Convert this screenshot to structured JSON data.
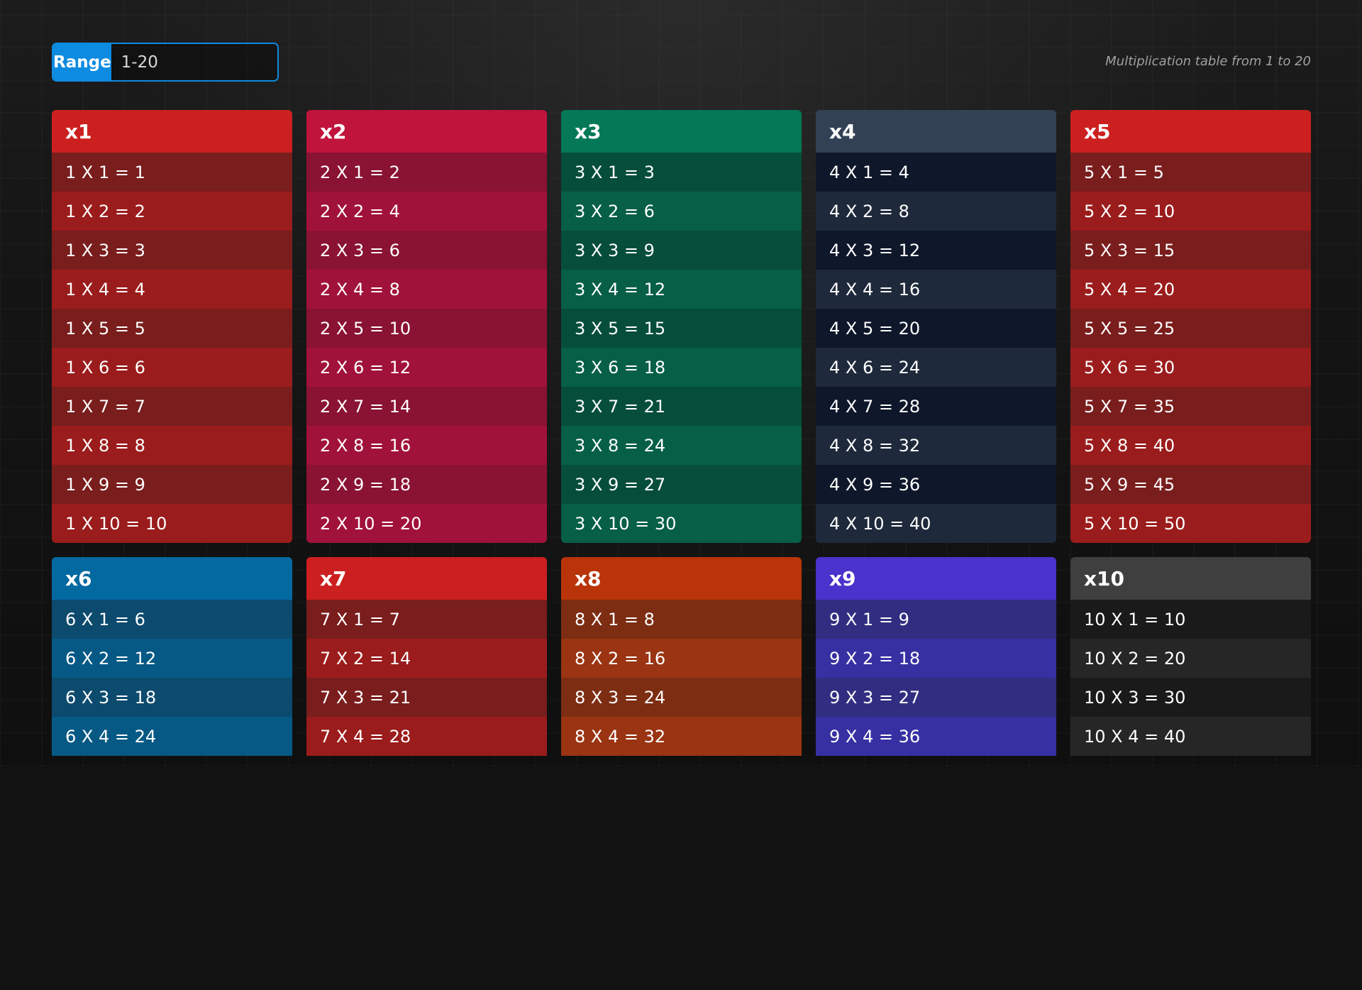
{
  "range": {
    "label": "Range",
    "value": "1-20"
  },
  "subtitle": "Multiplication table from 1 to 20",
  "tables": [
    {
      "title": "x1",
      "header": "#cc2020",
      "rowA": "#7a1d1d",
      "rowB": "#9b1c1c",
      "rows": [
        "1 X 1 = 1",
        "1 X 2 = 2",
        "1 X 3 = 3",
        "1 X 4 = 4",
        "1 X 5 = 5",
        "1 X 6 = 6",
        "1 X 7 = 7",
        "1 X 8 = 8",
        "1 X 9 = 9",
        "1 X 10 = 10"
      ]
    },
    {
      "title": "x2",
      "header": "#c0143d",
      "rowA": "#8a1233",
      "rowB": "#a1123a",
      "rows": [
        "2 X 1 = 2",
        "2 X 2 = 4",
        "2 X 3 = 6",
        "2 X 4 = 8",
        "2 X 5 = 10",
        "2 X 6 = 12",
        "2 X 7 = 14",
        "2 X 8 = 16",
        "2 X 9 = 18",
        "2 X 10 = 20"
      ]
    },
    {
      "title": "x3",
      "header": "#047857",
      "rowA": "#064e3b",
      "rowB": "#065f46",
      "rows": [
        "3 X 1 = 3",
        "3 X 2 = 6",
        "3 X 3 = 9",
        "3 X 4 = 12",
        "3 X 5 = 15",
        "3 X 6 = 18",
        "3 X 7 = 21",
        "3 X 8 = 24",
        "3 X 9 = 27",
        "3 X 10 = 30"
      ]
    },
    {
      "title": "x4",
      "header": "#334155",
      "rowA": "#0f172a",
      "rowB": "#1e293b",
      "rows": [
        "4 X 1 = 4",
        "4 X 2 = 8",
        "4 X 3 = 12",
        "4 X 4 = 16",
        "4 X 5 = 20",
        "4 X 6 = 24",
        "4 X 7 = 28",
        "4 X 8 = 32",
        "4 X 9 = 36",
        "4 X 10 = 40"
      ]
    },
    {
      "title": "x5",
      "header": "#cc2020",
      "rowA": "#7a1d1d",
      "rowB": "#9b1c1c",
      "rows": [
        "5 X 1 = 5",
        "5 X 2 = 10",
        "5 X 3 = 15",
        "5 X 4 = 20",
        "5 X 5 = 25",
        "5 X 6 = 30",
        "5 X 7 = 35",
        "5 X 8 = 40",
        "5 X 9 = 45",
        "5 X 10 = 50"
      ]
    },
    {
      "title": "x6",
      "header": "#0369a1",
      "rowA": "#0c4a6e",
      "rowB": "#075985",
      "rows": [
        "6 X 1 = 6",
        "6 X 2 = 12",
        "6 X 3 = 18",
        "6 X 4 = 24"
      ]
    },
    {
      "title": "x7",
      "header": "#cc2020",
      "rowA": "#7a1d1d",
      "rowB": "#9b1c1c",
      "rows": [
        "7 X 1 = 7",
        "7 X 2 = 14",
        "7 X 3 = 21",
        "7 X 4 = 28"
      ]
    },
    {
      "title": "x8",
      "header": "#b93408",
      "rowA": "#7c2d12",
      "rowB": "#9a3412",
      "rows": [
        "8 X 1 = 8",
        "8 X 2 = 16",
        "8 X 3 = 24",
        "8 X 4 = 32"
      ]
    },
    {
      "title": "x9",
      "header": "#4a32cc",
      "rowA": "#312e81",
      "rowB": "#3730a3",
      "rows": [
        "9 X 1 = 9",
        "9 X 2 = 18",
        "9 X 3 = 27",
        "9 X 4 = 36"
      ]
    },
    {
      "title": "x10",
      "header": "#3f3f3f",
      "rowA": "#1a1a1a",
      "rowB": "#262626",
      "rows": [
        "10 X 1 = 10",
        "10 X 2 = 20",
        "10 X 3 = 30",
        "10 X 4 = 40"
      ]
    }
  ]
}
